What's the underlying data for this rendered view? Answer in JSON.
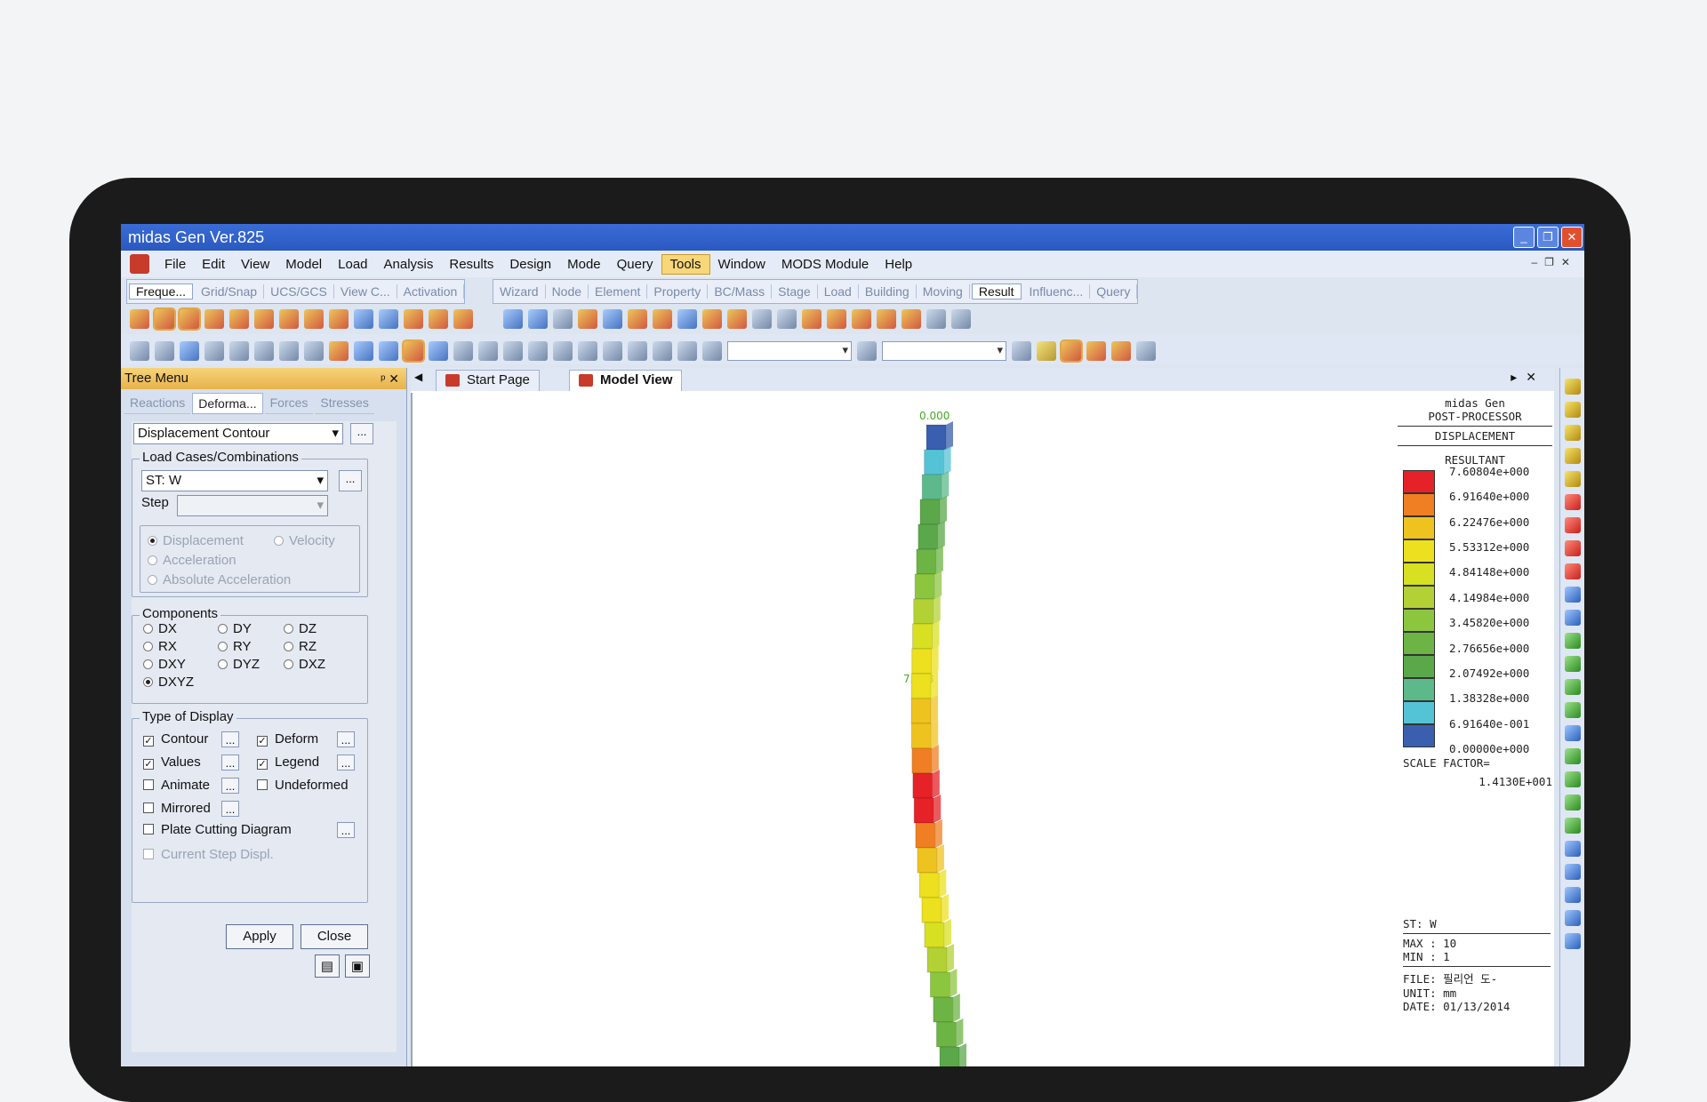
{
  "window": {
    "title": "midas Gen Ver.825"
  },
  "menu": [
    "File",
    "Edit",
    "View",
    "Model",
    "Load",
    "Analysis",
    "Results",
    "Design",
    "Mode",
    "Query",
    "Tools",
    "Window",
    "MODS Module",
    "Help"
  ],
  "menu_active": "Tools",
  "ribbon_tabs_left": [
    "Freque...",
    "Grid/Snap",
    "UCS/GCS",
    "View C...",
    "Activation"
  ],
  "ribbon_tabs_right": [
    "Wizard",
    "Node",
    "Element",
    "Property",
    "BC/Mass",
    "Stage",
    "Load",
    "Building",
    "Moving",
    "Result",
    "Influenc...",
    "Query"
  ],
  "ribbon_selected": {
    "left": "Freque...",
    "right": "Result"
  },
  "tree": {
    "header": "Tree Menu",
    "tabs": [
      "Reactions",
      "Deforma...",
      "Forces",
      "Stresses"
    ],
    "selected_tab": "Deforma...",
    "contour_type": "Displacement Contour",
    "load_group": "Load Cases/Combinations",
    "load_case": "ST: W",
    "step_label": "Step",
    "motion_options": [
      "Displacement",
      "Velocity",
      "Acceleration",
      "Absolute Acceleration"
    ],
    "components_label": "Components",
    "components": [
      "DX",
      "DY",
      "DZ",
      "RX",
      "RY",
      "RZ",
      "DXY",
      "DYZ",
      "DXZ",
      "DXYZ"
    ],
    "component_selected": "DXYZ",
    "display_label": "Type of Display",
    "display_options": {
      "contour": "Contour",
      "deform": "Deform",
      "values": "Values",
      "legend": "Legend",
      "animate": "Animate",
      "undeformed": "Undeformed",
      "mirrored": "Mirrored",
      "plate_cutting": "Plate Cutting Diagram",
      "current_step": "Current Step Displ."
    },
    "apply": "Apply",
    "close": "Close",
    "ellipsis": "..."
  },
  "doc_tabs": [
    "Start Page",
    "Model View"
  ],
  "active_doc_tab": "Model View",
  "model": {
    "top_value": "0.000",
    "mid_value": "7.608"
  },
  "legend": {
    "app": "midas Gen",
    "sub": "POST-PROCESSOR",
    "type": "DISPLACEMENT",
    "component": "RESULTANT",
    "values": [
      "7.60804e+000",
      "6.91640e+000",
      "6.22476e+000",
      "5.53312e+000",
      "4.84148e+000",
      "4.14984e+000",
      "3.45820e+000",
      "2.76656e+000",
      "2.07492e+000",
      "1.38328e+000",
      "6.91640e-001",
      "0.00000e+000"
    ],
    "colors": [
      "#e52227",
      "#ef7f22",
      "#efc31f",
      "#ece01f",
      "#d8e022",
      "#b3d134",
      "#8cc63f",
      "#6cb444",
      "#5aa84a",
      "#5cb98a",
      "#55c3d6",
      "#3a5fae"
    ],
    "scale_label": "SCALE FACTOR=",
    "scale_value": "1.4130E+001",
    "case": "ST: W",
    "max": "MAX : 10",
    "min": "MIN : 1",
    "file": "FILE: 필리언 도-",
    "unit": "UNIT: mm",
    "date": "DATE: 01/13/2014"
  }
}
